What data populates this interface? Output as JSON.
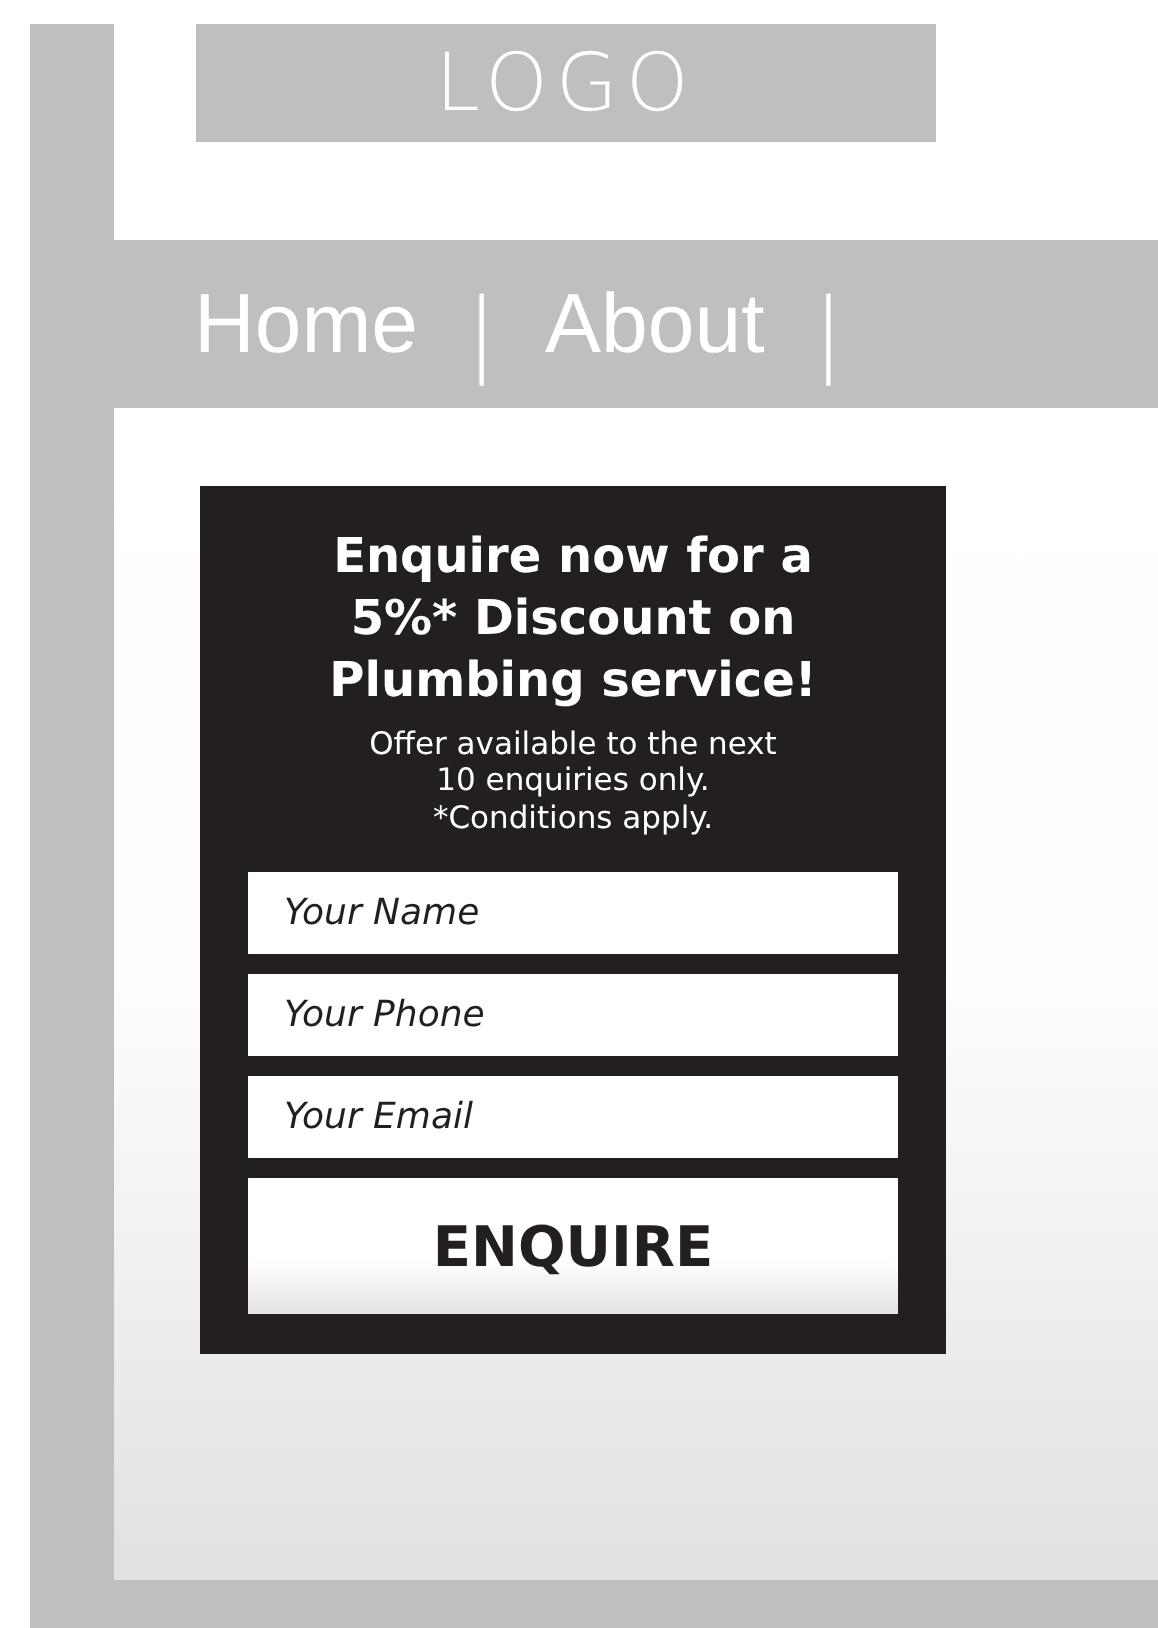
{
  "logo": {
    "text": "LOGO"
  },
  "nav": [
    {
      "label": "Home",
      "kind": "link"
    },
    {
      "label": "|",
      "kind": "separator"
    },
    {
      "label": "About",
      "kind": "link"
    },
    {
      "label": "|",
      "kind": "separator"
    }
  ],
  "enquiry_form": {
    "heading_lines": [
      "Enquire now for a",
      "5%* Discount on",
      "Plumbing service!"
    ],
    "offer_lines": [
      "Offer available to the next",
      "10 enquiries only.",
      "*Conditions apply."
    ],
    "fields": [
      {
        "placeholder": "Your Name"
      },
      {
        "placeholder": "Your Phone"
      },
      {
        "placeholder": "Your Email"
      }
    ],
    "submit": "ENQUIRE"
  }
}
